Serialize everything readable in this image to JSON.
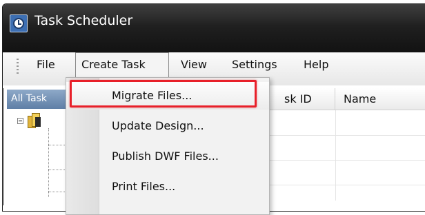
{
  "window": {
    "title": "Task Scheduler"
  },
  "menubar": {
    "items": [
      {
        "label": "File"
      },
      {
        "label": "Create Task"
      },
      {
        "label": "View"
      },
      {
        "label": "Settings"
      },
      {
        "label": "Help"
      }
    ]
  },
  "left_pane": {
    "header": "All Task"
  },
  "grid": {
    "columns": [
      {
        "label": "sk ID"
      },
      {
        "label": "Name"
      }
    ]
  },
  "dropdown": {
    "items": [
      {
        "label": "Migrate Files...",
        "highlighted": true
      },
      {
        "label": "Update Design...",
        "highlighted": false
      },
      {
        "label": "Publish DWF Files...",
        "highlighted": false
      },
      {
        "label": "Print Files...",
        "highlighted": false
      }
    ]
  },
  "colors": {
    "titlebar": "#1a1a1a",
    "highlight_outline": "#e8202a",
    "left_header": "#6f8db2"
  }
}
